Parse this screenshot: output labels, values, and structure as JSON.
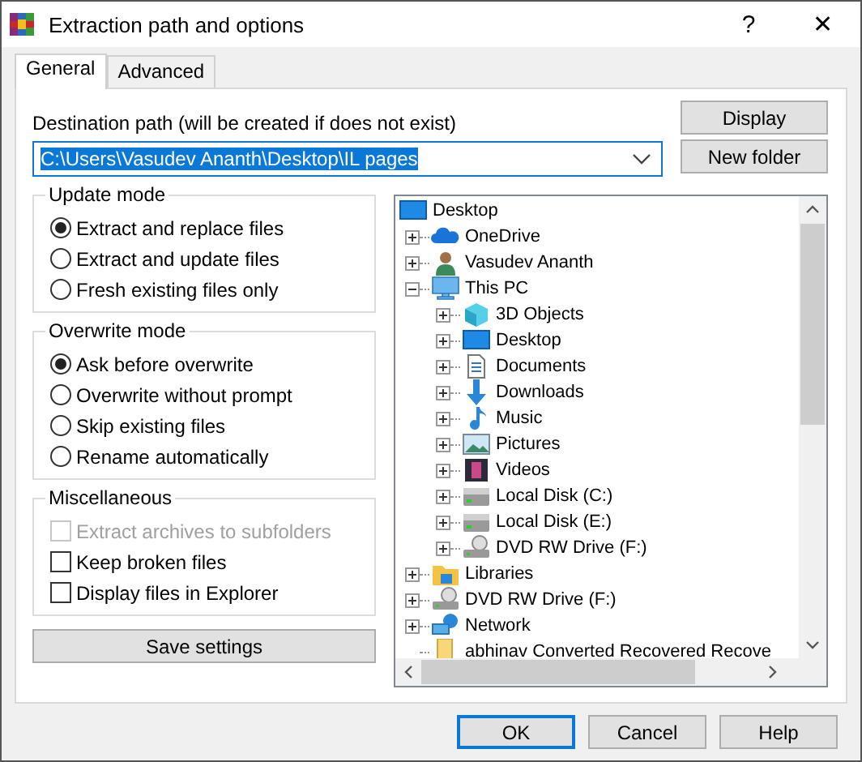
{
  "window": {
    "title": "Extraction path and options",
    "help": "?",
    "close": "✕"
  },
  "tabs": [
    {
      "label": "General",
      "selected": true
    },
    {
      "label": "Advanced",
      "selected": false
    }
  ],
  "destination": {
    "label": "Destination path (will be created if does not exist)",
    "value": "C:\\Users\\Vasudev Ananth\\Desktop\\IL pages"
  },
  "side_buttons": [
    "Display",
    "New folder"
  ],
  "groups": [
    {
      "title": "Update mode",
      "kind": "radio",
      "options": [
        {
          "label": "Extract and replace files",
          "selected": true
        },
        {
          "label": "Extract and update files",
          "selected": false
        },
        {
          "label": "Fresh existing files only",
          "selected": false
        }
      ]
    },
    {
      "title": "Overwrite mode",
      "kind": "radio",
      "options": [
        {
          "label": "Ask before overwrite",
          "selected": true
        },
        {
          "label": "Overwrite without prompt",
          "selected": false
        },
        {
          "label": "Skip existing files",
          "selected": false
        },
        {
          "label": "Rename automatically",
          "selected": false
        }
      ]
    },
    {
      "title": "Miscellaneous",
      "kind": "checkbox",
      "options": [
        {
          "label": "Extract archives to subfolders",
          "checked": false,
          "disabled": true
        },
        {
          "label": "Keep broken files",
          "checked": false,
          "disabled": false
        },
        {
          "label": "Display files in Explorer",
          "checked": false,
          "disabled": false
        }
      ]
    }
  ],
  "save_button": "Save settings",
  "tree": [
    {
      "label": "Desktop",
      "kind": "desktop",
      "children": [
        {
          "label": "OneDrive",
          "kind": "cloud",
          "expanded": false
        },
        {
          "label": "Vasudev Ananth",
          "kind": "user",
          "expanded": false
        },
        {
          "label": "This PC",
          "kind": "pc",
          "expanded": true,
          "children": [
            {
              "label": "3D Objects",
              "kind": "cube",
              "expanded": false
            },
            {
              "label": "Desktop",
              "kind": "desktop",
              "expanded": false
            },
            {
              "label": "Documents",
              "kind": "document",
              "expanded": false
            },
            {
              "label": "Downloads",
              "kind": "download",
              "expanded": false
            },
            {
              "label": "Music",
              "kind": "music",
              "expanded": false
            },
            {
              "label": "Pictures",
              "kind": "pictures",
              "expanded": false
            },
            {
              "label": "Videos",
              "kind": "videos",
              "expanded": false
            },
            {
              "label": "Local Disk (C:)",
              "kind": "disk",
              "expanded": false
            },
            {
              "label": "Local Disk (E:)",
              "kind": "disk",
              "expanded": false
            },
            {
              "label": "DVD RW Drive (F:)",
              "kind": "dvd",
              "expanded": false
            }
          ]
        },
        {
          "label": "Libraries",
          "kind": "libraries",
          "expanded": false
        },
        {
          "label": "DVD RW Drive (F:)",
          "kind": "dvd",
          "expanded": false
        },
        {
          "label": "Network",
          "kind": "network",
          "expanded": false
        },
        {
          "label": "abhinav Converted Recovered Recove",
          "kind": "folder"
        }
      ]
    }
  ],
  "buttons": [
    {
      "label": "OK",
      "focused": true
    },
    {
      "label": "Cancel",
      "focused": false
    },
    {
      "label": "Help",
      "focused": false
    }
  ]
}
